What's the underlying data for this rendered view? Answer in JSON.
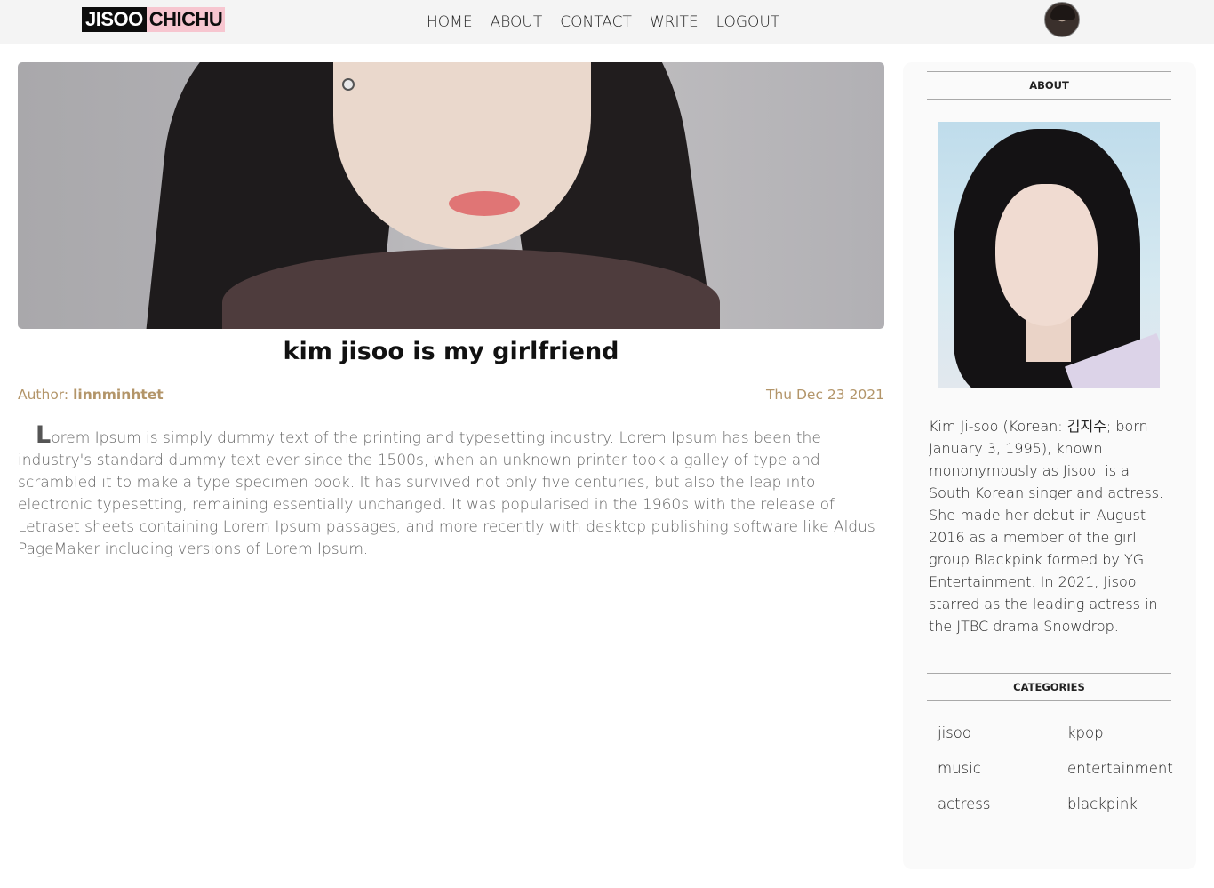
{
  "header": {
    "logo_part1": "JISOO",
    "logo_part2": "CHICHU",
    "nav": [
      "HOME",
      "ABOUT",
      "CONTACT",
      "WRITE",
      "LOGOUT"
    ]
  },
  "post": {
    "title": "kim jisoo is my girlfriend",
    "author_label": "Author: ",
    "author": "linnminhtet",
    "date": "Thu Dec 23 2021",
    "body": "Lorem Ipsum is simply dummy text of the printing and typesetting industry. Lorem Ipsum has been the industry's standard dummy text ever since the 1500s, when an unknown printer took a galley of type and scrambled it to make a type specimen book. It has survived not only five centuries, but also the leap into electronic typesetting, remaining essentially unchanged. It was popularised in the 1960s with the release of Letraset sheets containing Lorem Ipsum passages, and more recently with desktop publishing software like Aldus PageMaker including versions of Lorem Ipsum."
  },
  "sidebar": {
    "about_title": "ABOUT",
    "about_text": "Kim Ji-soo (Korean: 김지수; born January 3, 1995), known mononymously as Jisoo, is a South Korean singer and actress. She made her debut in August 2016 as a member of the girl group Blackpink formed by YG Entertainment. In 2021, Jisoo starred as the leading actress in the JTBC drama Snowdrop.",
    "categories_title": "CATEGORIES",
    "categories": [
      "jisoo",
      "kpop",
      "music",
      "entertainment",
      "actress",
      "blackpink"
    ]
  },
  "colors": {
    "topbar_bg": "#f4f4f4",
    "meta_accent": "#b39569",
    "logo_pink": "#f7c6d0"
  }
}
